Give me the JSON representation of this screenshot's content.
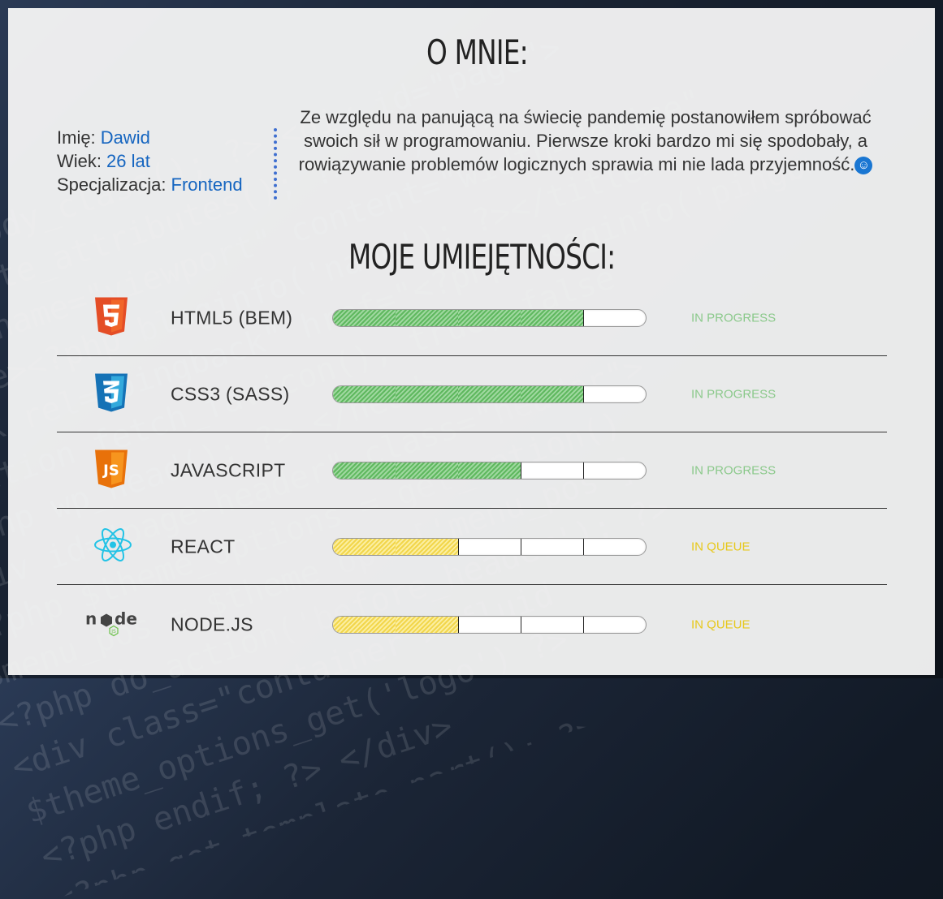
{
  "about": {
    "title": "O MNIE:",
    "info": [
      {
        "label": "Imię:",
        "value": "Dawid"
      },
      {
        "label": "Wiek:",
        "value": "26 lat"
      },
      {
        "label": "Specjalizacja:",
        "value": "Frontend"
      }
    ],
    "description": "Ze względu na panującą na świecię pandemię postanowiłem spróbować swoich sił w programowaniu. Pierwsze kroki bardzo mi się spodobały, a rowiązywanie problemów logicznych sprawia mi nie lada przyjemność."
  },
  "skills": {
    "title": "MOJE UMIEJĘTNOŚCI:",
    "items": [
      {
        "name": "HTML5 (BEM)",
        "icon": "html5-icon",
        "level": 4,
        "max": 5,
        "status": "IN PROGRESS",
        "color": "#5fb85f"
      },
      {
        "name": "CSS3 (SASS)",
        "icon": "css3-icon",
        "level": 4,
        "max": 5,
        "status": "IN PROGRESS",
        "color": "#5fb85f"
      },
      {
        "name": "JAVASCRIPT",
        "icon": "javascript-icon",
        "level": 3,
        "max": 5,
        "status": "IN PROGRESS",
        "color": "#5fb85f"
      },
      {
        "name": "REACT",
        "icon": "react-icon",
        "level": 2,
        "max": 5,
        "status": "IN QUEUE",
        "color": "#f2d64b"
      },
      {
        "name": "NODE.JS",
        "icon": "nodejs-icon",
        "level": 2,
        "max": 5,
        "status": "IN QUEUE",
        "color": "#f2d64b"
      }
    ]
  },
  "colors": {
    "accent": "#1565c0",
    "progress": "#5fb85f",
    "queue": "#f2d64b"
  }
}
